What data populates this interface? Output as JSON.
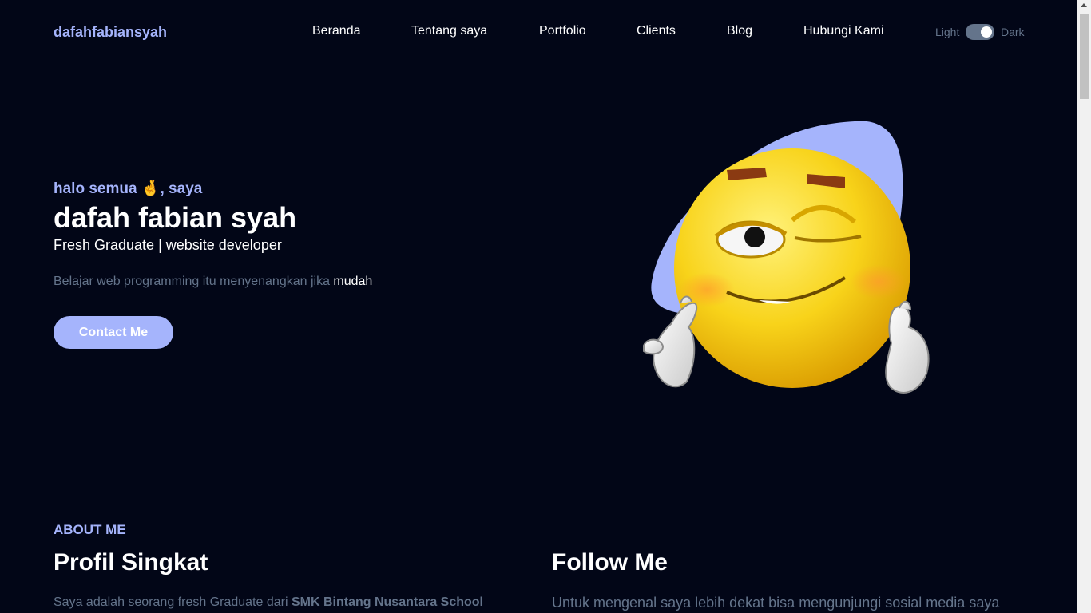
{
  "brand": "dafahfabiansyah",
  "nav": {
    "links": [
      "Beranda",
      "Tentang saya",
      "Portfolio",
      "Clients",
      "Blog",
      "Hubungi Kami"
    ],
    "toggle": {
      "light_label": "Light",
      "dark_label": "Dark",
      "state": "dark"
    }
  },
  "hero": {
    "greeting_prefix": "halo semua ",
    "greeting_emoji": "🤞",
    "greeting_suffix": ", saya",
    "name": "dafah fabian syah",
    "role": "Fresh Graduate | website developer",
    "tagline_prefix": "Belajar web programming itu menyenangkan jika ",
    "tagline_highlight": "mudah",
    "cta_label": "Contact Me",
    "image_icon": "winking-emoji-illustration"
  },
  "about": {
    "eyebrow": "ABOUT ME",
    "title": "Profil Singkat",
    "text_prefix": "Saya adalah seorang fresh Graduate dari ",
    "text_bold": "SMK Bintang Nusantara School"
  },
  "follow": {
    "title": "Follow Me",
    "text": "Untuk mengenal saya lebih dekat bisa mengunjungi sosial media saya"
  },
  "colors": {
    "background": "#020617",
    "accent": "#a5b4fc",
    "muted": "#64748b",
    "text": "#ffffff"
  }
}
